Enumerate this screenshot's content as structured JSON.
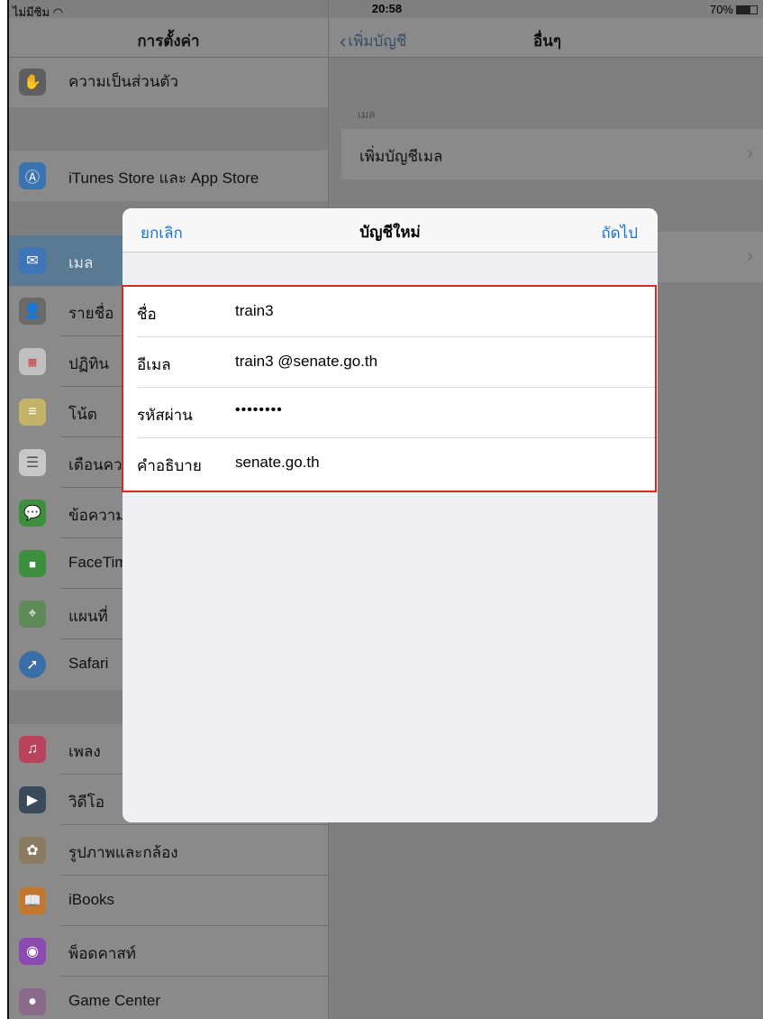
{
  "status": {
    "carrier": "ไม่มีซิม",
    "time": "20:58",
    "battery": "70%"
  },
  "sidebar": {
    "title": "การตั้งค่า",
    "items": [
      {
        "label": "ความเป็นส่วนตัว",
        "icon": "hand-icon",
        "color": "#5e5e60"
      },
      {
        "label": "iTunes Store และ App Store",
        "icon": "app-store-icon",
        "color": "#3a73b0"
      },
      {
        "label": "เมล",
        "icon": "mail-icon",
        "color": "#3f74b8"
      },
      {
        "label": "รายชื่อ",
        "icon": "contacts-icon",
        "color": "#6a6a6a"
      },
      {
        "label": "ปฏิทิน",
        "icon": "calendar-icon",
        "color": "#c0c0c0"
      },
      {
        "label": "โน้ต",
        "icon": "notes-icon",
        "color": "#c4b46a"
      },
      {
        "label": "เตือนควา",
        "icon": "reminders-icon",
        "color": "#c8c8c8"
      },
      {
        "label": "ข้อความ",
        "icon": "messages-icon",
        "color": "#3c8f3c"
      },
      {
        "label": "FaceTim",
        "icon": "facetime-icon",
        "color": "#3c8f3c"
      },
      {
        "label": "แผนที่",
        "icon": "maps-icon",
        "color": "#5d8a57"
      },
      {
        "label": "Safari",
        "icon": "safari-icon",
        "color": "#3a6ea6"
      },
      {
        "label": "เพลง",
        "icon": "music-icon",
        "color": "#b8435a"
      },
      {
        "label": "วิดีโอ",
        "icon": "videos-icon",
        "color": "#3a4a5a"
      },
      {
        "label": "รูปภาพและกล้อง",
        "icon": "photos-icon",
        "color": "#8a7a60"
      },
      {
        "label": "iBooks",
        "icon": "ibooks-icon",
        "color": "#c2782d"
      },
      {
        "label": "พ็อดคาสท์",
        "icon": "podcasts-icon",
        "color": "#8b4bb0"
      },
      {
        "label": "Game Center",
        "icon": "game-center-icon",
        "color": "#8a6a8a"
      }
    ]
  },
  "detail": {
    "back_label": "เพิ่มบัญชี",
    "title": "อื่นๆ",
    "section_header": "เมล",
    "add_mail_label": "เพิ่มบัญชีเมล"
  },
  "modal": {
    "cancel_label": "ยกเลิก",
    "title": "บัญชีใหม่",
    "next_label": "ถัดไป",
    "fields": [
      {
        "label": "ชื่อ",
        "value": "train3"
      },
      {
        "label": "อีเมล",
        "value": "train3 @senate.go.th"
      },
      {
        "label": "รหัสผ่าน",
        "value": "••••••••"
      },
      {
        "label": "คำอธิบาย",
        "value": "senate.go.th"
      }
    ]
  }
}
